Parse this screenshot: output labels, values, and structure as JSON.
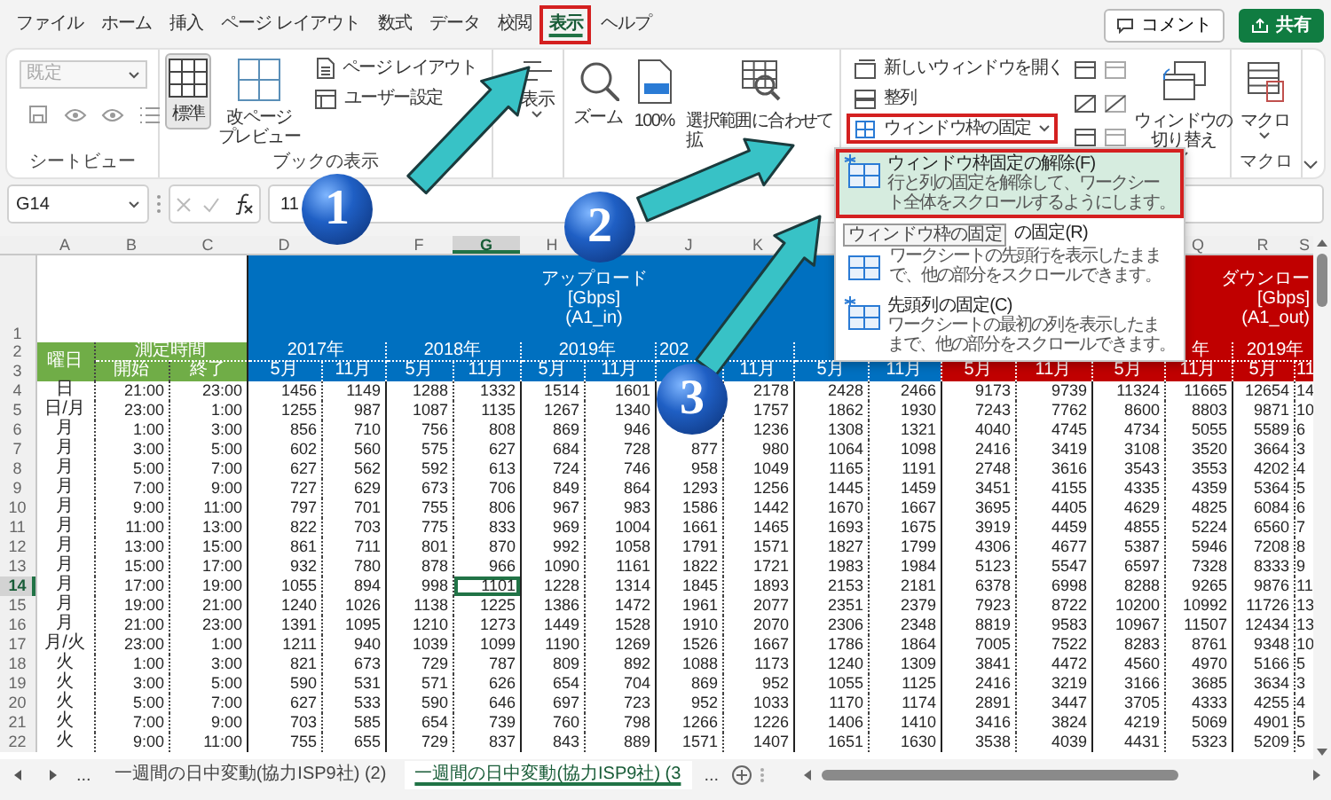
{
  "menu_tabs": [
    {
      "label": "ファイル",
      "selected": false
    },
    {
      "label": "ホーム",
      "selected": false
    },
    {
      "label": "挿入",
      "selected": false
    },
    {
      "label": "ページ レイアウト",
      "selected": false
    },
    {
      "label": "数式",
      "selected": false
    },
    {
      "label": "データ",
      "selected": false
    },
    {
      "label": "校閲",
      "selected": false
    },
    {
      "label": "表示",
      "selected": true
    },
    {
      "label": "ヘルプ",
      "selected": false
    }
  ],
  "header_buttons": [
    {
      "kind": "comment",
      "label": "コメント"
    },
    {
      "kind": "share",
      "label": "共有"
    }
  ],
  "ribbon_groups": [
    {
      "label": "シートビュー",
      "items": [
        {
          "kind": "dropdown",
          "value": "既定",
          "disabled": true
        },
        {
          "kind": "icon_row"
        }
      ]
    },
    {
      "label": "ブックの表示",
      "items": [
        {
          "kind": "large",
          "lines": [
            "標準"
          ],
          "selected": true
        },
        {
          "kind": "large",
          "lines": [
            "改ページ",
            "プレビュー"
          ],
          "selected": false
        },
        {
          "kind": "smalls",
          "entries": [
            {
              "label": "ページ レイアウト"
            },
            {
              "label": "ユーザー設定"
            }
          ]
        }
      ]
    },
    {
      "items": [
        {
          "kind": "large",
          "lines": [
            "表示"
          ],
          "dropdown": true
        }
      ]
    },
    {
      "items": [
        {
          "kind": "large",
          "lines": [
            "ズーム"
          ]
        },
        {
          "kind": "large",
          "lines": [
            "100%"
          ]
        },
        {
          "kind": "large",
          "lines": [
            "選択範囲に合わせて",
            "拡"
          ]
        }
      ]
    },
    {
      "items": [
        {
          "kind": "smalls",
          "entries": [
            {
              "label": "新しいウィンドウを開く"
            },
            {
              "label": "整列"
            },
            {
              "label": "ウィンドウ枠の固定",
              "dropdown": true,
              "expanded": true
            }
          ]
        },
        {
          "kind": "icon_grid"
        },
        {
          "kind": "large",
          "lines": [
            "ウィンドウの",
            "切り替え"
          ],
          "dropdown": true
        }
      ]
    },
    {
      "label": "マクロ",
      "items": [
        {
          "kind": "large",
          "lines": [
            "マクロ"
          ],
          "dropdown": true
        }
      ]
    }
  ],
  "freeze_menu": {
    "items": [
      {
        "title": "ウィンドウ枠固定の解除(F)",
        "description": [
          "行と列の固定を解除して、ワークシー",
          "ト全体をスクロールするようにします。"
        ],
        "selected": true
      },
      {
        "tooltip": "ウィンドウ枠の固定",
        "title": "の固定(R)",
        "description": [
          "ワークシートの先頭行を表示したまま",
          "で、他の部分をスクロールできます。"
        ],
        "selected": false
      },
      {
        "title": "先頭列の固定(C)",
        "description": [
          "ワークシートの最初の列を表示したま",
          "まで、他の部分をスクロールできます。"
        ],
        "selected": false
      }
    ]
  },
  "formula_bar": {
    "name_box": "G14",
    "value": "11"
  },
  "sheet": {
    "columns": [
      {
        "letter": "A",
        "selected": false
      },
      {
        "letter": "B",
        "selected": false
      },
      {
        "letter": "C",
        "selected": false
      },
      {
        "letter": "D",
        "selected": false
      },
      {},
      {
        "letter": "F",
        "selected": false
      },
      {
        "letter": "G",
        "selected": true
      },
      {
        "letter": "H",
        "selected": false
      },
      {},
      {
        "letter": "J",
        "selected": false
      },
      {
        "letter": "K",
        "selected": false
      },
      {},
      {},
      {},
      {},
      {},
      {
        "letter": "Q",
        "selected": false
      },
      {
        "letter": "R",
        "selected": false
      },
      {
        "letter": "S",
        "selected": false
      }
    ],
    "title_row": {
      "header": "1",
      "upload": [
        "アップロード",
        "[Gbps]",
        "(A1_in)"
      ],
      "download": [
        "ダウンロー",
        "[Gbps]",
        "(A1_out)"
      ]
    },
    "year_row": {
      "header": "2",
      "weekday": "曜日",
      "time": "測定時間",
      "upload": {
        "D": "2017年",
        "F": "2018年",
        "H": "2019年",
        "J": "202"
      },
      "download": {
        "P": "年",
        "R": "2019年"
      }
    },
    "month_row": {
      "header": "3",
      "start": "開始",
      "end": "終了",
      "months": {
        "D": "5月",
        "E": "11月",
        "F": "5月",
        "G": "11月",
        "H": "5月",
        "I": "11月",
        "K": "11月",
        "L": "5月",
        "M": "11月",
        "N": "5月",
        "O": "11月",
        "P": "5月",
        "Q": "11月",
        "R": "5月",
        "S": "11"
      }
    },
    "rows": [
      {
        "header": "4",
        "selected": false,
        "cells": [
          "日",
          "21:00",
          "23:00",
          "1456",
          "1149",
          "1288",
          "1332",
          "1514",
          "1601",
          {},
          "2178",
          "2428",
          "2466",
          "9173",
          "9739",
          "11324",
          "11665",
          "12654",
          "14"
        ]
      },
      {
        "header": "5",
        "selected": false,
        "cells": [
          "日/月",
          "23:00",
          "1:00",
          "1255",
          "987",
          "1087",
          "1135",
          "1267",
          "1340",
          {},
          "1757",
          "1862",
          "1930",
          "7243",
          "7762",
          "8600",
          "8803",
          "9871",
          "10"
        ]
      },
      {
        "header": "6",
        "selected": false,
        "cells": [
          "月",
          "1:00",
          "3:00",
          "856",
          "710",
          "756",
          "808",
          "869",
          "946",
          {},
          "1236",
          "1308",
          "1321",
          "4040",
          "4745",
          "4734",
          "5055",
          "5589",
          "6"
        ]
      },
      {
        "header": "7",
        "selected": false,
        "cells": [
          "月",
          "3:00",
          "5:00",
          "602",
          "560",
          "575",
          "627",
          "684",
          "728",
          "877",
          "980",
          "1064",
          "1098",
          "2416",
          "3419",
          "3108",
          "3520",
          "3664",
          "3"
        ]
      },
      {
        "header": "8",
        "selected": false,
        "cells": [
          "月",
          "5:00",
          "7:00",
          "627",
          "562",
          "592",
          "613",
          "724",
          "746",
          "958",
          "1049",
          "1165",
          "1191",
          "2748",
          "3616",
          "3543",
          "3553",
          "4202",
          "4"
        ]
      },
      {
        "header": "9",
        "selected": false,
        "cells": [
          "月",
          "7:00",
          "9:00",
          "727",
          "629",
          "673",
          "706",
          "849",
          "864",
          "1293",
          "1256",
          "1445",
          "1459",
          "3451",
          "4155",
          "4335",
          "4359",
          "5364",
          "5"
        ]
      },
      {
        "header": "10",
        "selected": false,
        "cells": [
          "月",
          "9:00",
          "11:00",
          "797",
          "701",
          "755",
          "806",
          "967",
          "983",
          "1586",
          "1442",
          "1670",
          "1667",
          "3695",
          "4405",
          "4629",
          "4825",
          "6084",
          "6"
        ]
      },
      {
        "header": "11",
        "selected": false,
        "cells": [
          "月",
          "11:00",
          "13:00",
          "822",
          "703",
          "775",
          "833",
          "969",
          "1004",
          "1661",
          "1465",
          "1693",
          "1675",
          "3919",
          "4459",
          "4855",
          "5224",
          "6560",
          "7"
        ]
      },
      {
        "header": "12",
        "selected": false,
        "cells": [
          "月",
          "13:00",
          "15:00",
          "861",
          "711",
          "801",
          "870",
          "992",
          "1058",
          "1791",
          "1571",
          "1827",
          "1799",
          "4306",
          "4677",
          "5387",
          "5946",
          "7208",
          "8"
        ]
      },
      {
        "header": "13",
        "selected": false,
        "cells": [
          "月",
          "15:00",
          "17:00",
          "932",
          "780",
          "878",
          "966",
          "1090",
          "1161",
          "1822",
          "1721",
          "1983",
          "1984",
          "5123",
          "5547",
          "6597",
          "7328",
          "8333",
          "9"
        ]
      },
      {
        "header": "14",
        "selected": true,
        "cells": [
          "月",
          "17:00",
          "19:00",
          "1055",
          "894",
          "998",
          "1101",
          "1228",
          "1314",
          "1845",
          "1893",
          "2153",
          "2181",
          "6378",
          "6998",
          "8288",
          "9265",
          "9876",
          "11"
        ]
      },
      {
        "header": "15",
        "selected": false,
        "cells": [
          "月",
          "19:00",
          "21:00",
          "1240",
          "1026",
          "1138",
          "1225",
          "1386",
          "1472",
          "1961",
          "2077",
          "2351",
          "2379",
          "7923",
          "8722",
          "10200",
          "10992",
          "11726",
          "13"
        ]
      },
      {
        "header": "16",
        "selected": false,
        "cells": [
          "月",
          "21:00",
          "23:00",
          "1391",
          "1095",
          "1210",
          "1273",
          "1449",
          "1528",
          "1910",
          "2070",
          "2306",
          "2348",
          "8819",
          "9583",
          "10967",
          "11507",
          "12434",
          "13"
        ]
      },
      {
        "header": "17",
        "selected": false,
        "cells": [
          "月/火",
          "23:00",
          "1:00",
          "1211",
          "940",
          "1039",
          "1099",
          "1190",
          "1269",
          "1526",
          "1667",
          "1786",
          "1864",
          "7005",
          "7522",
          "8283",
          "8761",
          "9348",
          "10"
        ]
      },
      {
        "header": "18",
        "selected": false,
        "cells": [
          "火",
          "1:00",
          "3:00",
          "821",
          "673",
          "729",
          "787",
          "809",
          "892",
          "1088",
          "1173",
          "1240",
          "1309",
          "3841",
          "4472",
          "4560",
          "4970",
          "5166",
          "5"
        ]
      },
      {
        "header": "19",
        "selected": false,
        "cells": [
          "火",
          "3:00",
          "5:00",
          "590",
          "531",
          "571",
          "626",
          "654",
          "704",
          "869",
          "952",
          "1055",
          "1125",
          "2416",
          "3219",
          "3166",
          "3685",
          "3634",
          "3"
        ]
      },
      {
        "header": "20",
        "selected": false,
        "cells": [
          "火",
          "5:00",
          "7:00",
          "627",
          "533",
          "590",
          "646",
          "697",
          "723",
          "952",
          "1033",
          "1170",
          "1174",
          "2891",
          "3447",
          "3705",
          "4333",
          "4255",
          "4"
        ]
      },
      {
        "header": "21",
        "selected": false,
        "cells": [
          "火",
          "7:00",
          "9:00",
          "703",
          "585",
          "654",
          "739",
          "760",
          "798",
          "1266",
          "1226",
          "1406",
          "1410",
          "3416",
          "3824",
          "4219",
          "5069",
          "4901",
          "5"
        ]
      },
      {
        "header": "22",
        "selected": false,
        "cells": [
          "火",
          "9:00",
          "11:00",
          "755",
          "655",
          "729",
          "837",
          "843",
          "889",
          "1571",
          "1407",
          "1651",
          "1630",
          "3538",
          "4039",
          "4431",
          "5323",
          "5209",
          "5"
        ]
      }
    ]
  },
  "sheet_tabs": {
    "more_left": "...",
    "tabs": [
      {
        "label": "一週間の日中変動(協力ISP9社) (2)",
        "selected": false
      },
      {
        "label": "一週間の日中変動(協力ISP9社) (3",
        "selected": true
      }
    ],
    "more_right": "..."
  },
  "callouts": [
    {
      "number": "1"
    },
    {
      "number": "2"
    },
    {
      "number": "3"
    }
  ]
}
